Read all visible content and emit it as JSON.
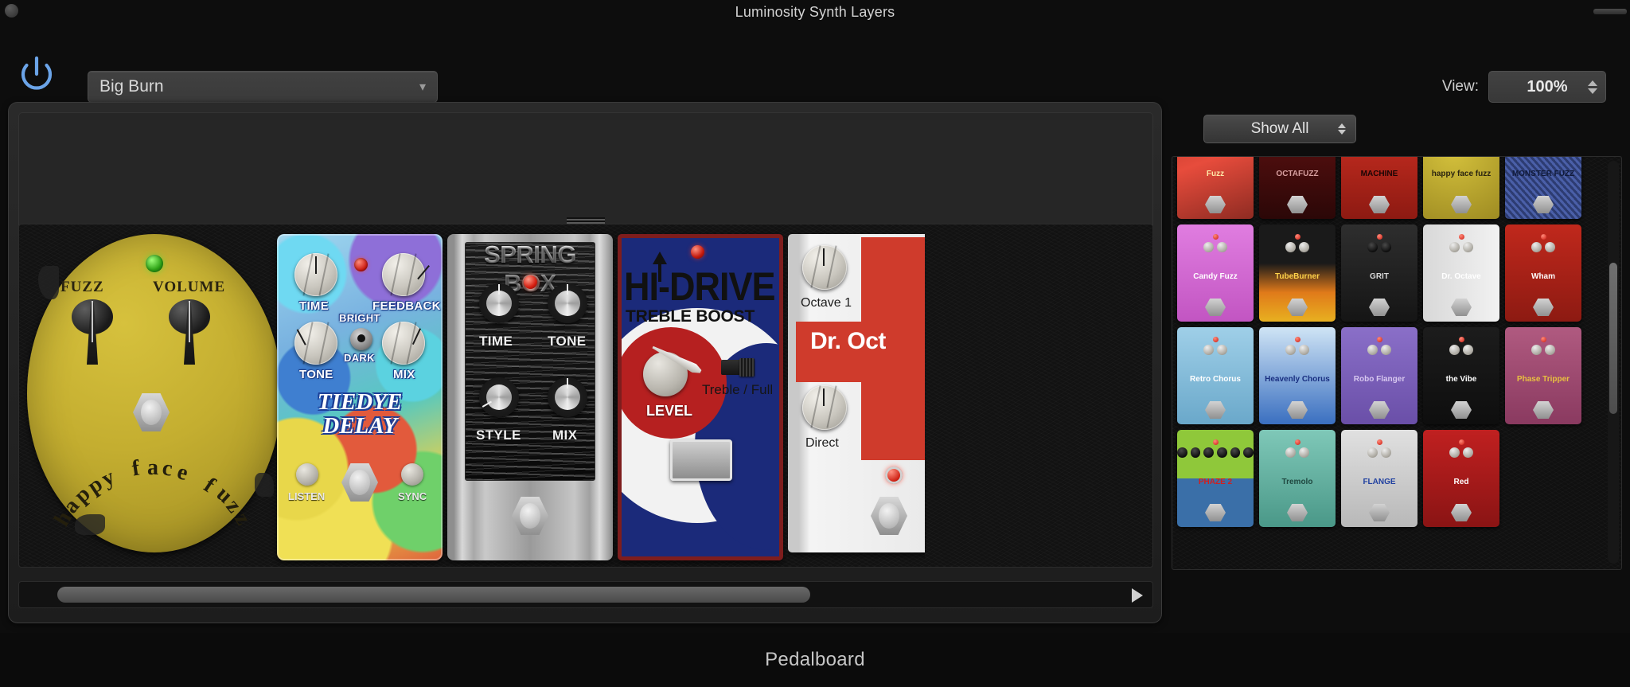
{
  "window": {
    "title": "Luminosity Synth Layers",
    "footer_label": "Pedalboard"
  },
  "header": {
    "power_icon": "power-icon",
    "preset_name": "Big Burn",
    "preset_chevron": "⌄",
    "view_label": "View:",
    "view_value": "100%"
  },
  "browser": {
    "filter_label": "Show All",
    "pedals": [
      {
        "name": "Fuzz",
        "style": "comic"
      },
      {
        "name": "OCTAFUZZ",
        "style": "octafuzz"
      },
      {
        "name": "MACHINE",
        "style": "machine"
      },
      {
        "name": "happy face fuzz",
        "style": "happyface"
      },
      {
        "name": "MONSTER FUZZ",
        "style": "monster"
      },
      {
        "name": "Candy Fuzz",
        "style": "candy"
      },
      {
        "name": "TubeBurner",
        "style": "tubeburner"
      },
      {
        "name": "GRIT",
        "style": "grit"
      },
      {
        "name": "Dr. Octave",
        "style": "droctave"
      },
      {
        "name": "Wham",
        "style": "wham"
      },
      {
        "name": "Retro Chorus",
        "style": "retro"
      },
      {
        "name": "Heavenly Chorus",
        "style": "heavenly"
      },
      {
        "name": "Robo Flanger",
        "style": "robo"
      },
      {
        "name": "the Vibe",
        "style": "vibe"
      },
      {
        "name": "Phase Tripper",
        "style": "phase"
      },
      {
        "name": "PHAZE 2",
        "style": "phaze"
      },
      {
        "name": "Tremolo",
        "style": "tremolo"
      },
      {
        "name": "FLANGE",
        "style": "flange"
      },
      {
        "name": "Red",
        "style": "redbox"
      }
    ]
  },
  "board": {
    "pedals": [
      {
        "id": "happy-face-fuzz",
        "name": "happy face fuzz",
        "knobs": [
          "FUZZ",
          "VOLUME"
        ],
        "led": "green"
      },
      {
        "id": "tie-dye-delay",
        "name": "TIE DYE DELAY",
        "name_line1": "TIEDYE",
        "name_line2": "DELAY",
        "knobs": [
          "TIME",
          "FEEDBACK",
          "TONE",
          "MIX"
        ],
        "switch_top": "BRIGHT",
        "switch_bottom": "DARK",
        "bottom_labels": [
          "LISTEN",
          "SYNC"
        ],
        "led": "red"
      },
      {
        "id": "spring-box",
        "name": "SPRING BOX",
        "knobs": [
          "TIME",
          "TONE",
          "STYLE",
          "MIX"
        ],
        "led": "red"
      },
      {
        "id": "hi-drive",
        "name": "HI-DRIVE",
        "subtitle": "TREBLE BOOST",
        "knobs": [
          "LEVEL"
        ],
        "switch_label": "Treble / Full",
        "led": "red"
      },
      {
        "id": "dr-octave",
        "name": "Dr. Oct",
        "knobs": [
          "Octave 1",
          "Direct"
        ],
        "led": "red"
      }
    ]
  }
}
